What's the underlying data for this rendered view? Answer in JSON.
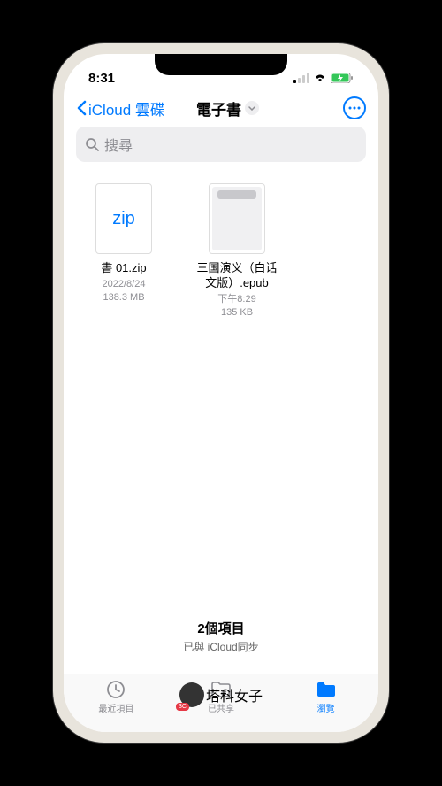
{
  "status": {
    "time": "8:31"
  },
  "nav": {
    "back_label": "iCloud 雲碟",
    "title": "電子書"
  },
  "search": {
    "placeholder": "搜尋"
  },
  "files": [
    {
      "name": "書 01.zip",
      "date": "2022/8/24",
      "size": "138.3 MB",
      "type": "zip",
      "icon_text": "zip"
    },
    {
      "name": "三国演义（白话文版）.epub",
      "date": "下午8:29",
      "size": "135 KB",
      "type": "epub"
    }
  ],
  "footer": {
    "count": "2個項目",
    "sync": "已與 iCloud同步"
  },
  "tabs": [
    {
      "label": "最近項目"
    },
    {
      "label": "已共享"
    },
    {
      "label": "瀏覽"
    }
  ],
  "watermark": "塔科女子"
}
